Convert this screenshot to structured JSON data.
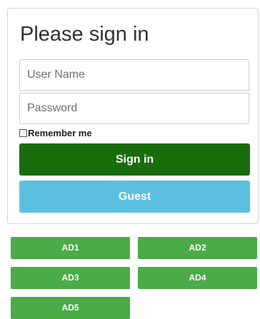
{
  "login": {
    "title": "Please sign in",
    "username_placeholder": "User Name",
    "password_placeholder": "Password",
    "remember_label": "Remember me",
    "signin_label": "Sign in",
    "guest_label": "Guest"
  },
  "ad_buttons": [
    {
      "label": "AD1"
    },
    {
      "label": "AD2"
    },
    {
      "label": "AD3"
    },
    {
      "label": "AD4"
    },
    {
      "label": "AD5"
    }
  ],
  "colors": {
    "signin": "#1a6d0d",
    "guest": "#5bc0de",
    "ad": "#4aab47"
  }
}
